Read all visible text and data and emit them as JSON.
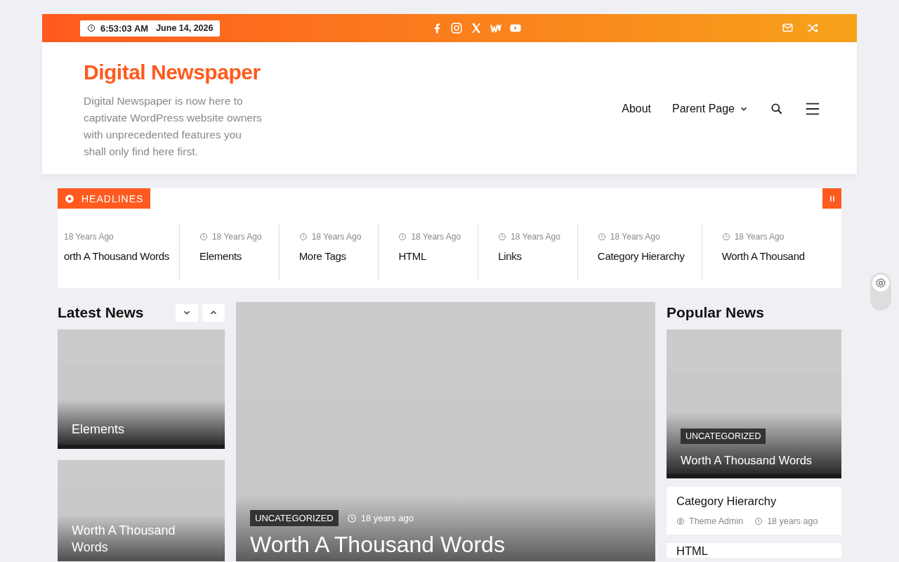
{
  "top_bar": {
    "time": "6:53:03 AM",
    "date": "June 14, 2026"
  },
  "header": {
    "site_title": "Digital Newspaper",
    "tagline": "Digital Newspaper is now here to captivate WordPress website owners with unprecedented features you shall only find here first.",
    "nav": [
      {
        "label": "About",
        "dropdown": false
      },
      {
        "label": "Parent Page",
        "dropdown": true
      }
    ]
  },
  "ticker": {
    "label": "HEADLINES",
    "items": [
      {
        "time": "18 Years Ago",
        "title": "orth A Thousand Words"
      },
      {
        "time": "18 Years Ago",
        "title": "Elements"
      },
      {
        "time": "18 Years Ago",
        "title": "More Tags"
      },
      {
        "time": "18 Years Ago",
        "title": "HTML"
      },
      {
        "time": "18 Years Ago",
        "title": "Links"
      },
      {
        "time": "18 Years Ago",
        "title": "Category Hierarchy"
      },
      {
        "time": "18 Years Ago",
        "title": "Worth A Thousand"
      }
    ]
  },
  "latest_news": {
    "heading": "Latest News",
    "cards": [
      {
        "title": "Elements"
      },
      {
        "title": "Worth A Thousand Words"
      }
    ]
  },
  "featured": {
    "category": "UNCATEGORIZED",
    "time": "18 years ago",
    "title": "Worth A Thousand Words"
  },
  "popular_news": {
    "heading": "Popular News",
    "lead": {
      "category": "UNCATEGORIZED",
      "title": "Worth A Thousand Words"
    },
    "items": [
      {
        "title": "Category Hierarchy",
        "author": "Theme Admin",
        "time": "18 years ago"
      },
      {
        "title": "HTML"
      }
    ]
  }
}
